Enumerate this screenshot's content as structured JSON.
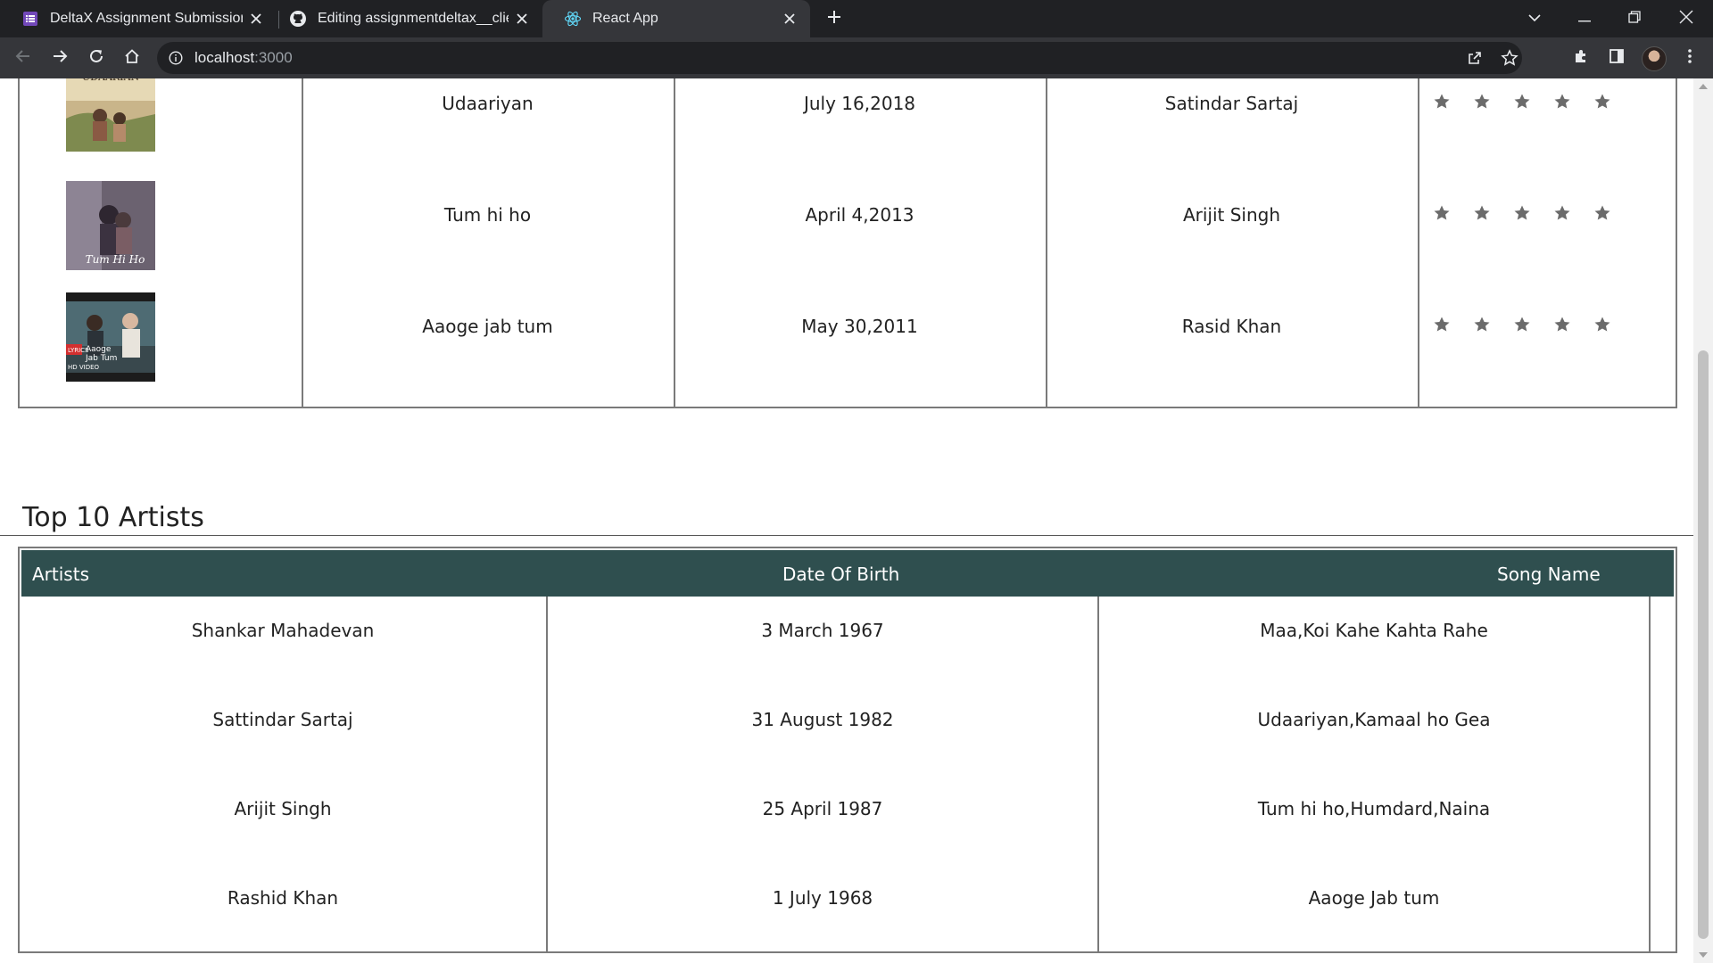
{
  "browser": {
    "tabs": [
      {
        "title": "DeltaX Assignment Submission -",
        "icon": "forms-icon",
        "active": false
      },
      {
        "title": "Editing assignmentdeltax__client/",
        "icon": "github-icon",
        "active": false
      },
      {
        "title": "React App",
        "icon": "react-icon",
        "active": true
      }
    ],
    "address": {
      "host": "localhost",
      "port": ":3000"
    }
  },
  "songs": {
    "rows": [
      {
        "cover": "Udaariyan cover",
        "title": "Udaariyan",
        "release_date": "July 16,2018",
        "artist": "Satindar Sartaj",
        "rating_stars": 5
      },
      {
        "cover": "Tum hi ho cover",
        "title": "Tum hi ho",
        "release_date": "April 4,2013",
        "artist": "Arijit Singh",
        "rating_stars": 5
      },
      {
        "cover": "Aaoge jab tum cover",
        "title": "Aaoge jab tum",
        "release_date": "May 30,2011",
        "artist": "Rasid Khan",
        "rating_stars": 5
      }
    ]
  },
  "artists_section": {
    "title": "Top 10 Artists",
    "headers": {
      "artists": "Artists",
      "dob": "Date Of Birth",
      "songs": "Song Name"
    },
    "rows": [
      {
        "name": "Shankar Mahadevan",
        "dob": "3 March 1967",
        "songs": "Maa,Koi Kahe Kahta Rahe"
      },
      {
        "name": "Sattindar Sartaj",
        "dob": "31 August 1982",
        "songs": "Udaariyan,Kamaal ho Gea"
      },
      {
        "name": "Arijit Singh",
        "dob": "25 April 1987",
        "songs": "Tum hi ho,Humdard,Naina"
      },
      {
        "name": "Rashid Khan",
        "dob": "1 July 1968",
        "songs": "Aaoge Jab tum"
      }
    ]
  },
  "colors": {
    "table_header_bg": "#2f4f4f",
    "star": "#6b6b6b",
    "chrome_dark": "#202124",
    "chrome_toolbar": "#35363a"
  }
}
